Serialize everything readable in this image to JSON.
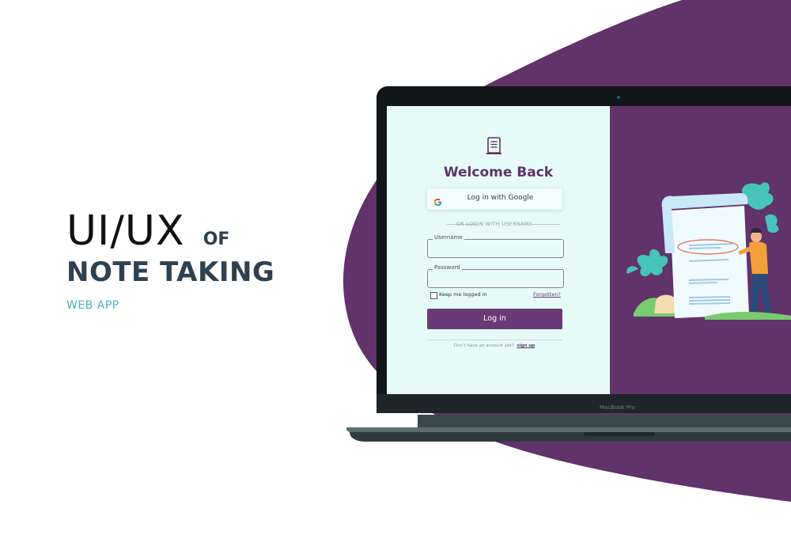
{
  "hero": {
    "title_line1": "UI/UX",
    "title_of": "OF",
    "title_line2": "NOTE TAKING",
    "subtitle": "WEB APP"
  },
  "device": {
    "model_label": "MacBook Pro"
  },
  "login": {
    "heading": "Welcome Back",
    "google_button": "Log in with Google",
    "divider": "OR LOGIN WITH USERNAME",
    "username_label": "Username",
    "password_label": "Password",
    "remember": "Keep me logged in",
    "forgot": "Forgotten?",
    "submit": "Log in",
    "signup_prompt": "Don't have an account yet?",
    "signup_link": "sign up"
  },
  "colors": {
    "brand_purple": "#62326b",
    "button_purple": "#6b3a76",
    "login_panel": "#e6fbf8",
    "hero_text": "#2f4150",
    "accent_teal": "#4ab0bf"
  },
  "icons": [
    "note-icon",
    "google-icon",
    "plant-icon",
    "person-illustration"
  ]
}
